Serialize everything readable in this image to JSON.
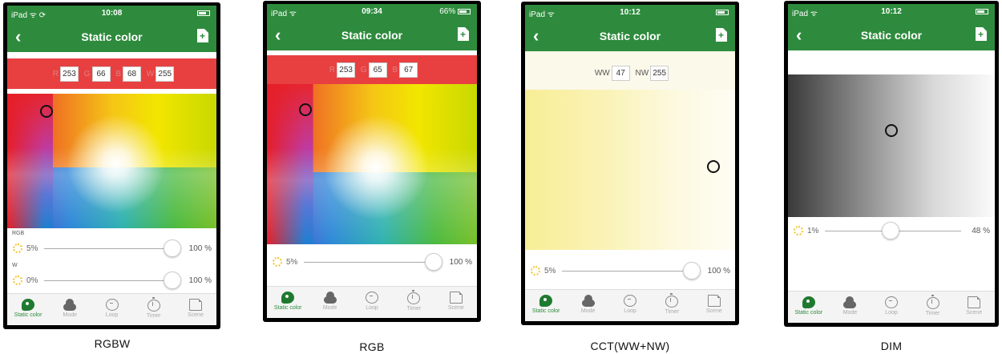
{
  "statusbar": [
    {
      "left": "iPad ᯤ ⟳",
      "time": "10:08",
      "right": ""
    },
    {
      "left": "iPad ᯤ",
      "time": "09:34",
      "right": "66%"
    },
    {
      "left": "iPad ᯤ",
      "time": "10:12",
      "right": ""
    },
    {
      "left": "iPad ᯤ",
      "time": "10:12",
      "right": ""
    }
  ],
  "navbar": {
    "back": "‹",
    "title": "Static color"
  },
  "rgbw": {
    "labels": {
      "r": "R",
      "g": "G",
      "b": "B",
      "w": "W"
    },
    "values": {
      "r": "253",
      "g": "66",
      "b": "68",
      "w": "255"
    },
    "rgb_label": "RGB",
    "rgb_left": "5%",
    "rgb_right": "100 %",
    "rgb_level": 1.0,
    "w_label": "W",
    "w_left": "0%",
    "w_right": "100 %",
    "w_level": 1.0,
    "caption": "RGBW"
  },
  "rgb": {
    "labels": {
      "r": "R",
      "g": "G",
      "b": "B"
    },
    "values": {
      "r": "253",
      "g": "65",
      "b": "67"
    },
    "left": "5%",
    "right": "100 %",
    "level": 1.0,
    "caption": "RGB"
  },
  "cct": {
    "labels": {
      "ww": "WW",
      "nw": "NW"
    },
    "values": {
      "ww": "47",
      "nw": "255"
    },
    "left": "5%",
    "right": "100 %",
    "level": 1.0,
    "caption": "CCT(WW+NW)"
  },
  "dim": {
    "left": "1%",
    "right": "48 %",
    "level": 0.48,
    "caption": "DIM"
  },
  "tabs": [
    {
      "label": "Static color",
      "icon": "palette-icon",
      "active": true
    },
    {
      "label": "Mode",
      "icon": "cloud-icon",
      "active": false
    },
    {
      "label": "Loop",
      "icon": "loop-icon",
      "active": false
    },
    {
      "label": "Timer",
      "icon": "timer-icon",
      "active": false
    },
    {
      "label": "Scene",
      "icon": "scene-icon",
      "active": false
    }
  ],
  "colors": {
    "green": "#2e8b3d",
    "red_bar": "#e84040",
    "cream_bar": "#fbf9ea",
    "active_tab": "#2e8b3d"
  }
}
